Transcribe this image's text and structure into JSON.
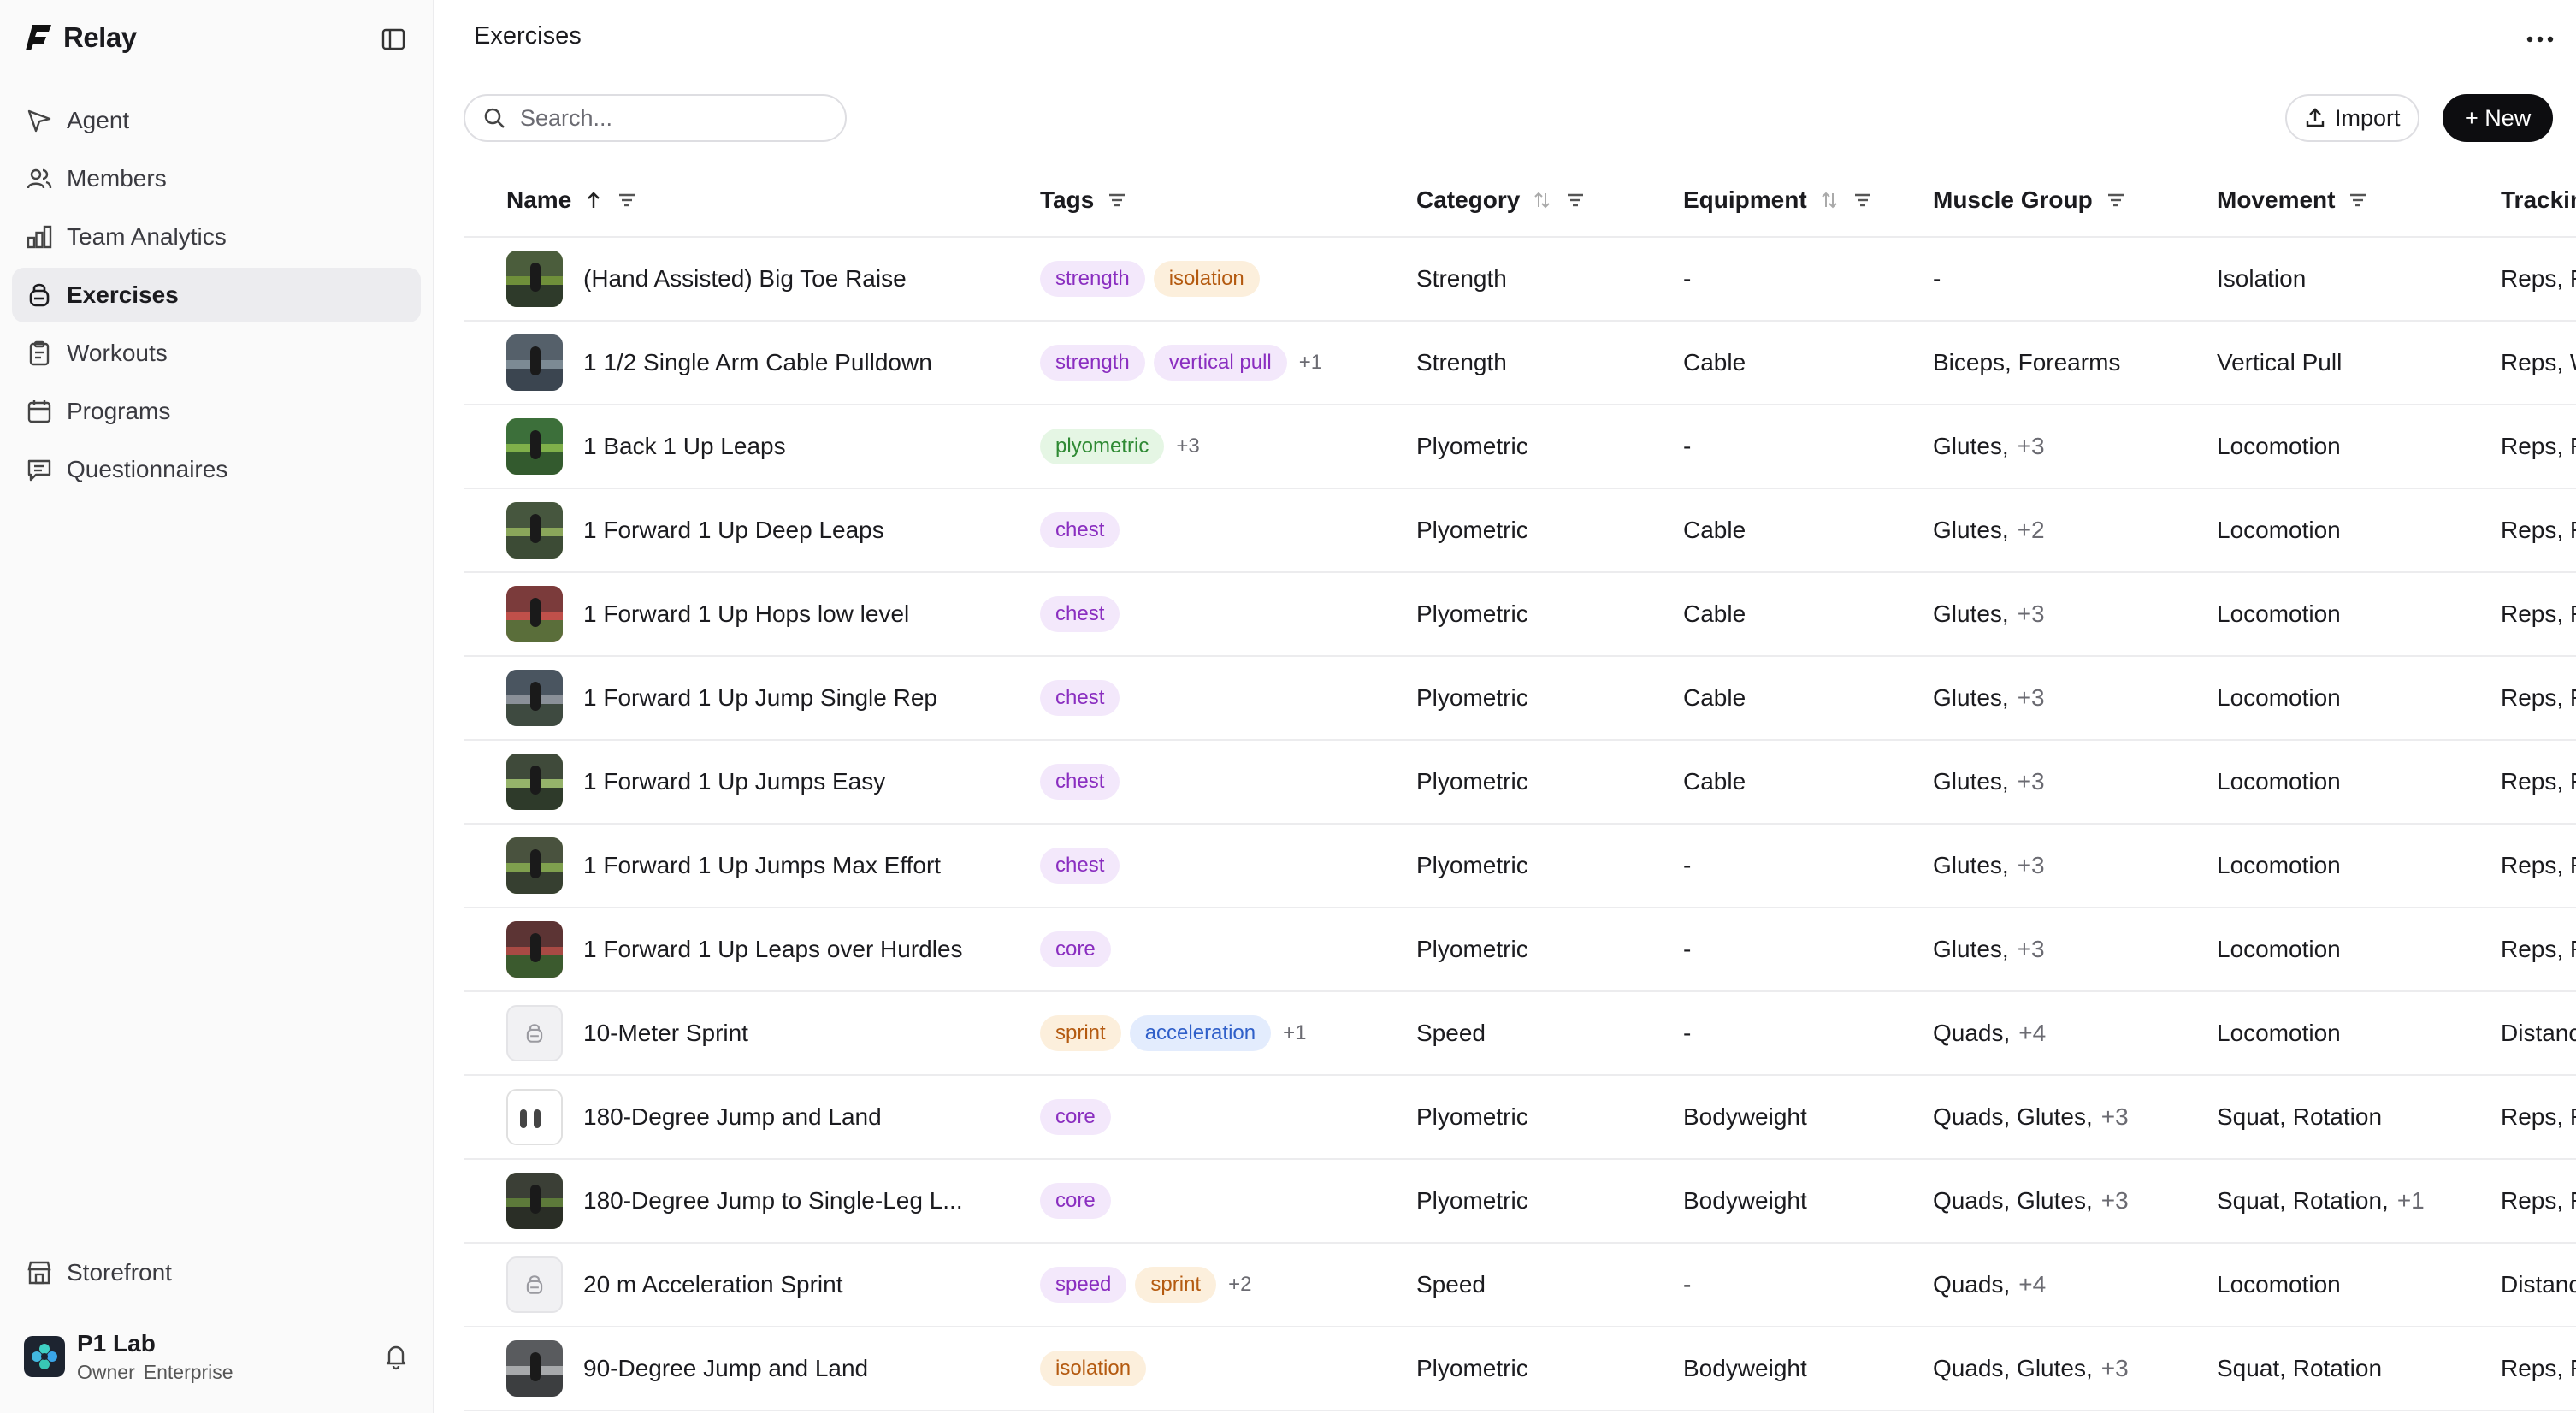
{
  "brand": {
    "name": "Relay"
  },
  "sidebar": {
    "items": [
      {
        "label": "Agent",
        "icon": "send-icon",
        "active": false
      },
      {
        "label": "Members",
        "icon": "users-icon",
        "active": false
      },
      {
        "label": "Team Analytics",
        "icon": "bar-chart-icon",
        "active": false
      },
      {
        "label": "Exercises",
        "icon": "kettlebell-icon",
        "active": true
      },
      {
        "label": "Workouts",
        "icon": "clipboard-icon",
        "active": false
      },
      {
        "label": "Programs",
        "icon": "calendar-icon",
        "active": false
      },
      {
        "label": "Questionnaires",
        "icon": "message-icon",
        "active": false
      }
    ],
    "storefront": {
      "label": "Storefront",
      "icon": "store-icon"
    },
    "account": {
      "name": "P1 Lab",
      "role": "Owner",
      "plan": "Enterprise"
    }
  },
  "header": {
    "title": "Exercises"
  },
  "toolbar": {
    "search_placeholder": "Search...",
    "import_label": "Import",
    "new_label": "+ New"
  },
  "table": {
    "columns": [
      {
        "label": "Name",
        "sort": "asc",
        "filter": true
      },
      {
        "label": "Tags",
        "sort": "none",
        "filter": true
      },
      {
        "label": "Category",
        "sort": "both",
        "filter": true
      },
      {
        "label": "Equipment",
        "sort": "both",
        "filter": true
      },
      {
        "label": "Muscle Group",
        "sort": "none",
        "filter": true
      },
      {
        "label": "Movement",
        "sort": "none",
        "filter": true
      },
      {
        "label": "Tracking F",
        "sort": "none",
        "filter": false
      }
    ],
    "rows": [
      {
        "name": "(Hand Assisted) Big Toe Raise",
        "thumb": "photo",
        "tags": [
          {
            "t": "strength",
            "c": "purple"
          },
          {
            "t": "isolation",
            "c": "orange"
          }
        ],
        "more": "",
        "category": "Strength",
        "equipment": "-",
        "muscle": "-",
        "muscle_more": "",
        "movement": "Isolation",
        "movement_more": "",
        "tracking": "Reps, RIR,"
      },
      {
        "name": "1 1/2 Single Arm Cable Pulldown",
        "thumb": "photo",
        "tags": [
          {
            "t": "strength",
            "c": "purple"
          },
          {
            "t": "vertical pull",
            "c": "purple"
          }
        ],
        "more": "+1",
        "category": "Strength",
        "equipment": "Cable",
        "muscle": "Biceps, Forearms",
        "muscle_more": "",
        "movement": "Vertical Pull",
        "movement_more": "",
        "tracking": "Reps, Wei"
      },
      {
        "name": "1 Back 1 Up Leaps",
        "thumb": "photo",
        "tags": [
          {
            "t": "plyometric",
            "c": "green"
          }
        ],
        "more": "+3",
        "category": "Plyometric",
        "equipment": "-",
        "muscle": "Glutes,",
        "muscle_more": "+3",
        "movement": "Locomotion",
        "movement_more": "",
        "tracking": "Reps, RPE"
      },
      {
        "name": "1 Forward 1 Up Deep Leaps",
        "thumb": "photo",
        "tags": [
          {
            "t": "chest",
            "c": "purple"
          }
        ],
        "more": "",
        "category": "Plyometric",
        "equipment": "Cable",
        "muscle": "Glutes,",
        "muscle_more": "+2",
        "movement": "Locomotion",
        "movement_more": "",
        "tracking": "Reps, RPE"
      },
      {
        "name": "1 Forward 1 Up Hops low level",
        "thumb": "photo",
        "tags": [
          {
            "t": "chest",
            "c": "purple"
          }
        ],
        "more": "",
        "category": "Plyometric",
        "equipment": "Cable",
        "muscle": "Glutes,",
        "muscle_more": "+3",
        "movement": "Locomotion",
        "movement_more": "",
        "tracking": "Reps, RPE"
      },
      {
        "name": "1 Forward 1 Up Jump Single Rep",
        "thumb": "photo",
        "tags": [
          {
            "t": "chest",
            "c": "purple"
          }
        ],
        "more": "",
        "category": "Plyometric",
        "equipment": "Cable",
        "muscle": "Glutes,",
        "muscle_more": "+3",
        "movement": "Locomotion",
        "movement_more": "",
        "tracking": "Reps, RPE"
      },
      {
        "name": "1 Forward 1 Up Jumps Easy",
        "thumb": "photo",
        "tags": [
          {
            "t": "chest",
            "c": "purple"
          }
        ],
        "more": "",
        "category": "Plyometric",
        "equipment": "Cable",
        "muscle": "Glutes,",
        "muscle_more": "+3",
        "movement": "Locomotion",
        "movement_more": "",
        "tracking": "Reps, RPE"
      },
      {
        "name": "1 Forward 1 Up Jumps Max Effort",
        "thumb": "photo",
        "tags": [
          {
            "t": "chest",
            "c": "purple"
          }
        ],
        "more": "",
        "category": "Plyometric",
        "equipment": "-",
        "muscle": "Glutes,",
        "muscle_more": "+3",
        "movement": "Locomotion",
        "movement_more": "",
        "tracking": "Reps, RPE"
      },
      {
        "name": "1 Forward 1 Up Leaps over Hurdles",
        "thumb": "photo",
        "tags": [
          {
            "t": "core",
            "c": "purple"
          }
        ],
        "more": "",
        "category": "Plyometric",
        "equipment": "-",
        "muscle": "Glutes,",
        "muscle_more": "+3",
        "movement": "Locomotion",
        "movement_more": "",
        "tracking": "Reps, RPE"
      },
      {
        "name": "10-Meter Sprint",
        "thumb": "placeholder",
        "tags": [
          {
            "t": "sprint",
            "c": "orange"
          },
          {
            "t": "acceleration",
            "c": "blue"
          }
        ],
        "more": "+1",
        "category": "Speed",
        "equipment": "-",
        "muscle": "Quads,",
        "muscle_more": "+4",
        "movement": "Locomotion",
        "movement_more": "",
        "tracking": "Distance,"
      },
      {
        "name": "180-Degree Jump and Land",
        "thumb": "white",
        "tags": [
          {
            "t": "core",
            "c": "purple"
          }
        ],
        "more": "",
        "category": "Plyometric",
        "equipment": "Bodyweight",
        "muscle": "Quads, Glutes,",
        "muscle_more": "+3",
        "movement": "Squat, Rotation",
        "movement_more": "",
        "tracking": "Reps, Res"
      },
      {
        "name": "180-Degree Jump to Single-Leg L...",
        "thumb": "photo",
        "tags": [
          {
            "t": "core",
            "c": "purple"
          }
        ],
        "more": "",
        "category": "Plyometric",
        "equipment": "Bodyweight",
        "muscle": "Quads, Glutes,",
        "muscle_more": "+3",
        "movement": "Squat, Rotation,",
        "movement_more": "+1",
        "tracking": "Reps, Res"
      },
      {
        "name": "20 m Acceleration Sprint",
        "thumb": "placeholder",
        "tags": [
          {
            "t": "speed",
            "c": "purple"
          },
          {
            "t": "sprint",
            "c": "orange"
          }
        ],
        "more": "+2",
        "category": "Speed",
        "equipment": "-",
        "muscle": "Quads,",
        "muscle_more": "+4",
        "movement": "Locomotion",
        "movement_more": "",
        "tracking": "Distance,"
      },
      {
        "name": "90-Degree Jump and Land",
        "thumb": "photo",
        "tags": [
          {
            "t": "isolation",
            "c": "orange"
          }
        ],
        "more": "",
        "category": "Plyometric",
        "equipment": "Bodyweight",
        "muscle": "Quads, Glutes,",
        "muscle_more": "+3",
        "movement": "Squat, Rotation",
        "movement_more": "",
        "tracking": "Reps, Res"
      }
    ]
  },
  "colors": {
    "accent": "#0d0d10",
    "tag_purple": "#8a2ec0",
    "tag_orange": "#b45a10",
    "tag_green": "#2f8a34",
    "tag_blue": "#2f5fc9"
  }
}
